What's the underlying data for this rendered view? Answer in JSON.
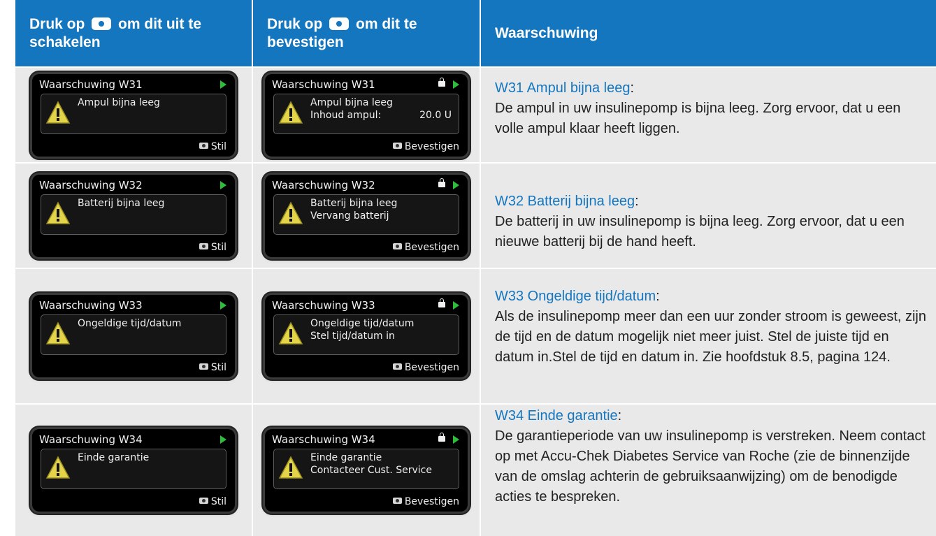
{
  "header": {
    "col1_pre": "Druk op",
    "col1_post": "om dit uit te",
    "col1_line2": "schakelen",
    "col2_pre": "Druk op",
    "col2_post": "om dit te",
    "col2_line2": "bevestigen",
    "col3": "Waarschuwing"
  },
  "colors": {
    "header_bg": "#1476bf",
    "row_bg": "#e9e9e9",
    "link": "#1476bf",
    "play": "#2ebd3a"
  },
  "rows": [
    {
      "screen1": {
        "title": "Waarschuwing W31",
        "line1": "Ampul bijna leeg",
        "action": "Stil"
      },
      "screen2": {
        "title": "Waarschuwing W31",
        "line1": "Ampul bijna leeg",
        "line2": "Inhoud ampul:",
        "value": "20.0 U",
        "action": "Bevestigen"
      },
      "desc": {
        "head": "W31 Ampul bijna leeg",
        "body": "De ampul in uw insulinepomp is bijna leeg. Zorg ervoor, dat u een volle ampul klaar heeft liggen."
      }
    },
    {
      "screen1": {
        "title": "Waarschuwing W32",
        "line1": "Batterij bijna leeg",
        "action": "Stil"
      },
      "screen2": {
        "title": "Waarschuwing W32",
        "line1": "Batterij bijna leeg",
        "line2": "Vervang batterij",
        "value": "",
        "action": "Bevestigen"
      },
      "desc": {
        "head": "W32 Batterij bijna leeg",
        "body": "De batterij in uw insulinepomp is bijna leeg. Zorg ervoor, dat u een nieuwe batterij bij de hand heeft."
      }
    },
    {
      "screen1": {
        "title": "Waarschuwing W33",
        "line1": "Ongeldige tijd/datum",
        "action": "Stil"
      },
      "screen2": {
        "title": "Waarschuwing W33",
        "line1": "Ongeldige tijd/datum",
        "line2": "Stel tijd/datum in",
        "value": "",
        "action": "Bevestigen"
      },
      "desc": {
        "head": "W33 Ongeldige tijd/datum",
        "body": "Als de insulinepomp meer dan een uur zonder stroom is geweest, zijn de tijd en de datum mogelijk niet meer juist. Stel de juiste tijd en datum in.Stel de tijd en datum in. Zie hoofdstuk 8.5, pagina 124."
      }
    },
    {
      "screen1": {
        "title": "Waarschuwing W34",
        "line1": "Einde garantie",
        "action": "Stil"
      },
      "screen2": {
        "title": "Waarschuwing W34",
        "line1": "Einde garantie",
        "line2": "Contacteer Cust. Service",
        "value": "",
        "action": "Bevestigen"
      },
      "desc": {
        "head": "W34 Einde garantie",
        "body": "De garantieperiode van uw insulinepomp is verstreken. Neem contact op met Accu-Chek Diabetes Service van Roche (zie de binnenzijde van de omslag achterin de gebruiksaanwijzing) om de benodigde acties te bespreken."
      }
    }
  ]
}
